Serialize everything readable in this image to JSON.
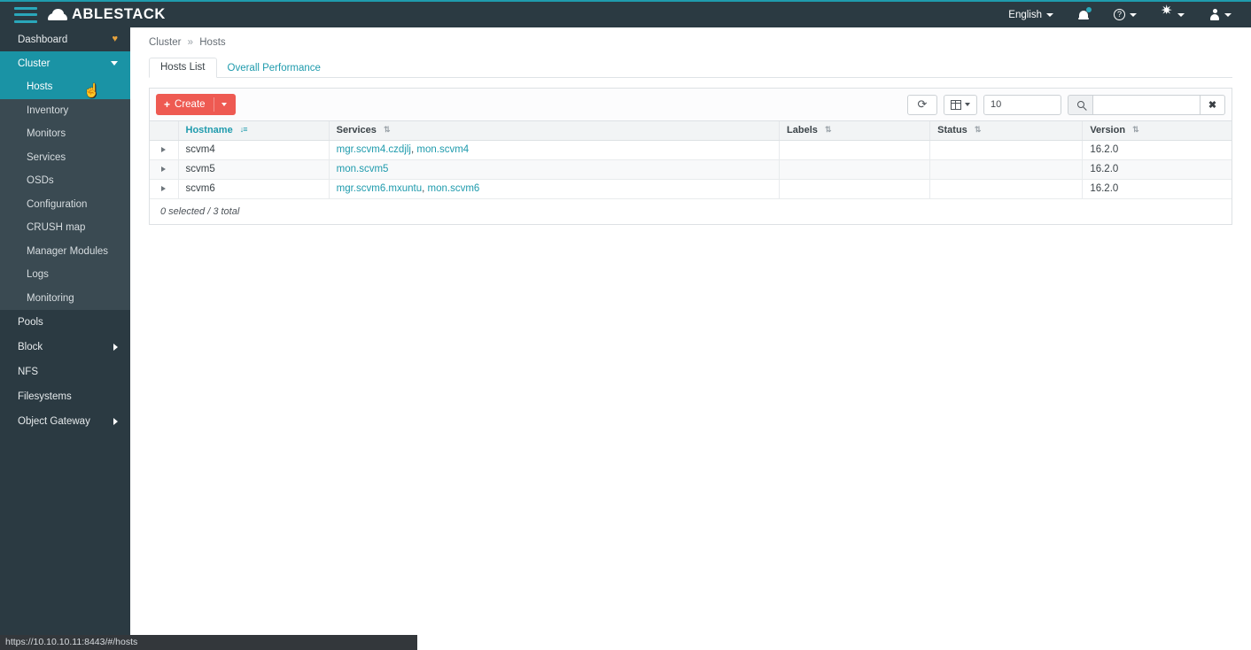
{
  "topbar": {
    "brand": "ABLESTACK",
    "menu_icon": "hamburger-icon",
    "language": "English",
    "notifications_icon": "bell-icon",
    "help_icon": "help-circle-icon",
    "settings_icon": "gear-icon",
    "user_icon": "user-icon"
  },
  "sidebar": {
    "items": [
      {
        "label": "Dashboard",
        "icon": "heart-health-icon",
        "state": "normal",
        "level": "top"
      },
      {
        "label": "Cluster",
        "icon": "chevron-down-icon",
        "state": "active",
        "level": "top"
      },
      {
        "label": "Hosts",
        "state": "active-child",
        "level": "child"
      },
      {
        "label": "Inventory",
        "state": "normal",
        "level": "child"
      },
      {
        "label": "Monitors",
        "state": "normal",
        "level": "child"
      },
      {
        "label": "Services",
        "state": "normal",
        "level": "child"
      },
      {
        "label": "OSDs",
        "state": "normal",
        "level": "child"
      },
      {
        "label": "Configuration",
        "state": "normal",
        "level": "child"
      },
      {
        "label": "CRUSH map",
        "state": "normal",
        "level": "child"
      },
      {
        "label": "Manager Modules",
        "state": "normal",
        "level": "child"
      },
      {
        "label": "Logs",
        "state": "normal",
        "level": "child"
      },
      {
        "label": "Monitoring",
        "state": "normal",
        "level": "child"
      },
      {
        "label": "Pools",
        "state": "normal",
        "level": "top"
      },
      {
        "label": "Block",
        "icon": "chevron-right-icon",
        "state": "normal",
        "level": "top"
      },
      {
        "label": "NFS",
        "state": "normal",
        "level": "top"
      },
      {
        "label": "Filesystems",
        "state": "normal",
        "level": "top"
      },
      {
        "label": "Object Gateway",
        "icon": "chevron-right-icon",
        "state": "normal",
        "level": "top"
      }
    ]
  },
  "breadcrumb": {
    "root": "Cluster",
    "separator": "»",
    "current": "Hosts"
  },
  "tabs": [
    {
      "label": "Hosts List",
      "active": true
    },
    {
      "label": "Overall Performance",
      "active": false
    }
  ],
  "toolbar": {
    "create_label": "Create",
    "plus_glyph": "+",
    "refresh_icon": "refresh-icon",
    "refresh_glyph": "⟳",
    "columns_icon": "table-columns-icon",
    "page_size_value": "10",
    "search_icon": "search-icon",
    "search_value": "",
    "search_placeholder": "",
    "clear_glyph": "✖"
  },
  "table": {
    "columns": [
      {
        "label": "",
        "key": "expand",
        "sortable": false
      },
      {
        "label": "Hostname",
        "key": "hostname",
        "sortable": true,
        "sorted": true,
        "sort_glyph": "↓≡"
      },
      {
        "label": "Services",
        "key": "services",
        "sortable": true,
        "sorted": false,
        "sort_glyph": "⇅"
      },
      {
        "label": "Labels",
        "key": "labels",
        "sortable": true,
        "sorted": false,
        "sort_glyph": "⇅"
      },
      {
        "label": "Status",
        "key": "status",
        "sortable": true,
        "sorted": false,
        "sort_glyph": "⇅"
      },
      {
        "label": "Version",
        "key": "version",
        "sortable": true,
        "sorted": false,
        "sort_glyph": "⇅"
      }
    ],
    "rows": [
      {
        "hostname": "scvm4",
        "services": [
          {
            "text": "mgr.scvm4.czdjlj",
            "link": true
          },
          {
            "text": ", ",
            "link": false
          },
          {
            "text": "mon.scvm4",
            "link": true
          }
        ],
        "labels": "",
        "status": "",
        "version": "16.2.0"
      },
      {
        "hostname": "scvm5",
        "services": [
          {
            "text": "mon.scvm5",
            "link": true
          }
        ],
        "labels": "",
        "status": "",
        "version": "16.2.0"
      },
      {
        "hostname": "scvm6",
        "services": [
          {
            "text": "mgr.scvm6.mxuntu",
            "link": true
          },
          {
            "text": ", ",
            "link": false
          },
          {
            "text": "mon.scvm6",
            "link": true
          }
        ],
        "labels": "",
        "status": "",
        "version": "16.2.0"
      }
    ],
    "footer": "0 selected / 3 total"
  },
  "statusbar": {
    "url": "https://10.10.10.11:8443/#/hosts"
  },
  "colors": {
    "navbar_bg": "#2b3a42",
    "accent_teal": "#1f9bad",
    "active_teal": "#1a93a5",
    "create_red": "#ee5a52",
    "sidebar_child_bg": "#3a4a52",
    "health_orange": "#e8a33d"
  }
}
